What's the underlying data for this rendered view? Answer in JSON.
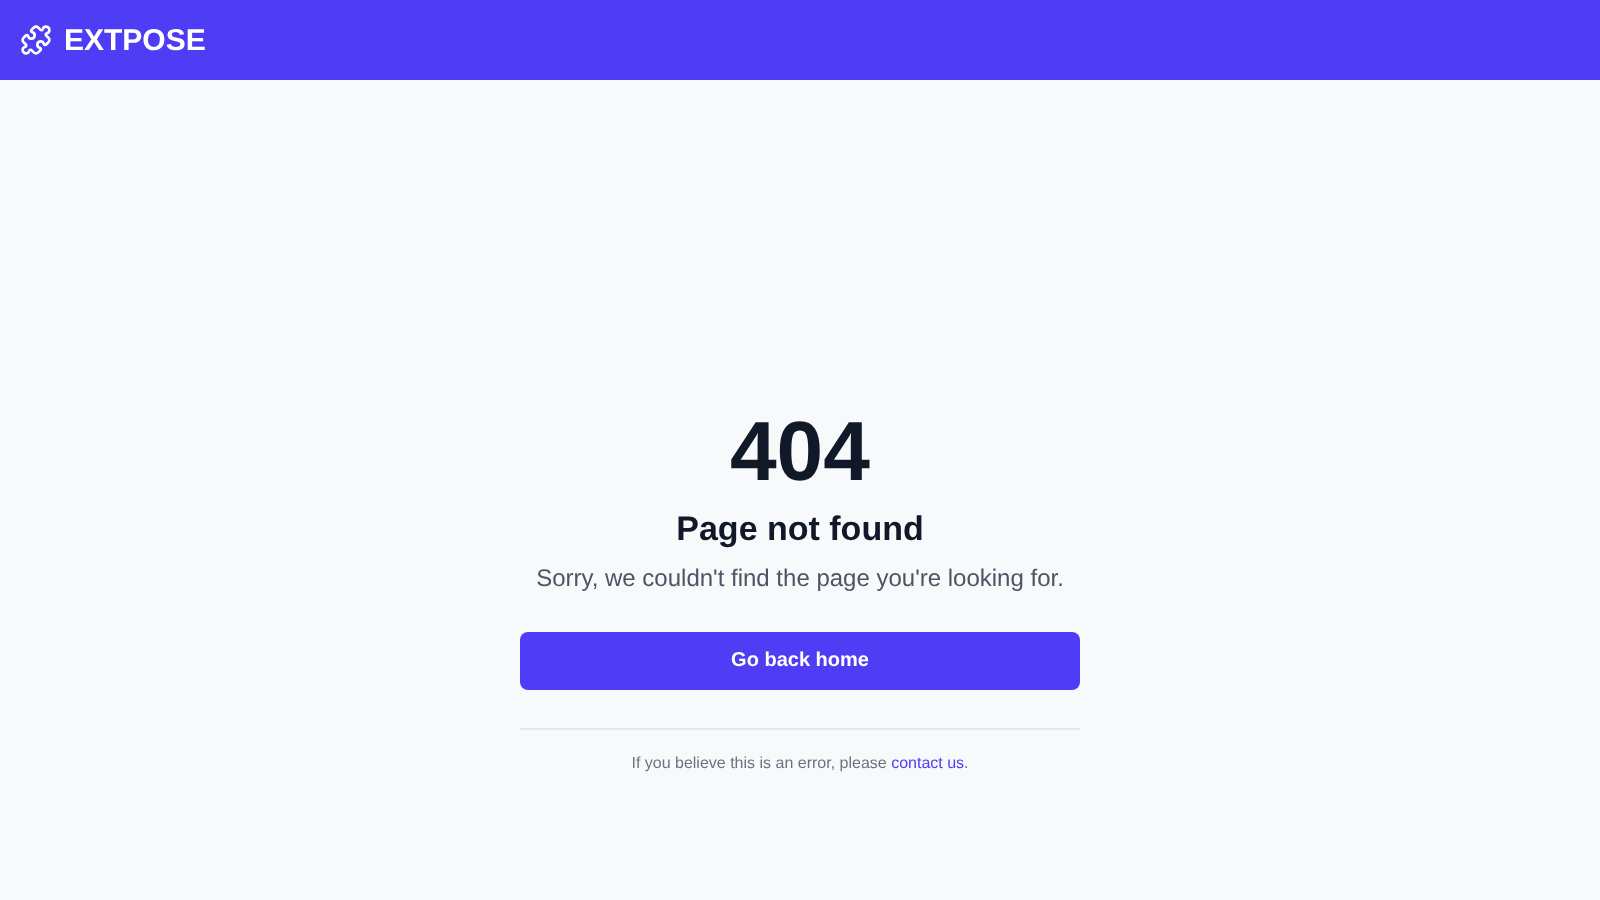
{
  "header": {
    "brand": "EXTPOSE"
  },
  "error": {
    "code": "404",
    "title": "Page not found",
    "message": "Sorry, we couldn't find the page you're looking for.",
    "button": "Go back home"
  },
  "footnote": {
    "text": "If you believe this is an error, please ",
    "link": "contact us",
    "suffix": "."
  }
}
